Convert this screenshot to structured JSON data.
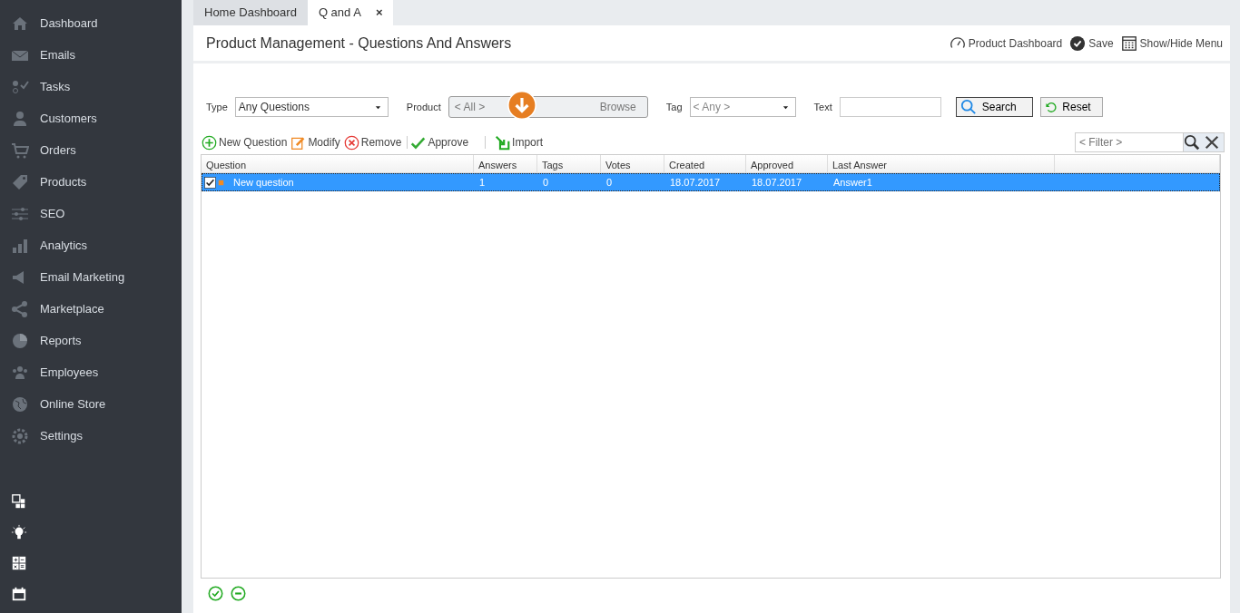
{
  "sidebar": {
    "items": [
      {
        "label": "Dashboard"
      },
      {
        "label": "Emails"
      },
      {
        "label": "Tasks"
      },
      {
        "label": "Customers"
      },
      {
        "label": "Orders"
      },
      {
        "label": "Products"
      },
      {
        "label": "SEO"
      },
      {
        "label": "Analytics"
      },
      {
        "label": "Email Marketing"
      },
      {
        "label": "Marketplace"
      },
      {
        "label": "Reports"
      },
      {
        "label": "Employees"
      },
      {
        "label": "Online Store"
      },
      {
        "label": "Settings"
      }
    ]
  },
  "tabs": [
    {
      "label": "Home Dashboard",
      "selected": false
    },
    {
      "label": "Q and A",
      "selected": true,
      "close": "×"
    }
  ],
  "header": {
    "title": "Product Management - Questions And Answers",
    "actions": [
      {
        "label": "Product Dashboard"
      },
      {
        "label": "Save"
      },
      {
        "label": "Show/Hide Menu"
      }
    ]
  },
  "filters": {
    "type": {
      "label": "Type",
      "value": "Any Questions"
    },
    "product": {
      "label": "Product",
      "value": "< All >",
      "button": "Browse"
    },
    "tag": {
      "label": "Tag",
      "value": "< Any >"
    },
    "text": {
      "label": "Text"
    },
    "search": "Search",
    "reset": "Reset"
  },
  "toolbar": [
    {
      "label": "New Question"
    },
    {
      "label": "Modify"
    },
    {
      "label": "Remove"
    },
    {
      "label": "Approve"
    },
    {
      "label": "Import"
    }
  ],
  "grid_filter": {
    "placeholder": "< Filter >"
  },
  "table": {
    "columns": [
      "Question",
      "Answers",
      "Tags",
      "Votes",
      "Created",
      "Approved",
      "Last Answer"
    ],
    "rows": [
      {
        "selected": true,
        "checked": true,
        "cells": [
          "New question",
          "1",
          "0",
          "0",
          "18.07.2017",
          "18.07.2017",
          "Answer1"
        ]
      }
    ]
  }
}
